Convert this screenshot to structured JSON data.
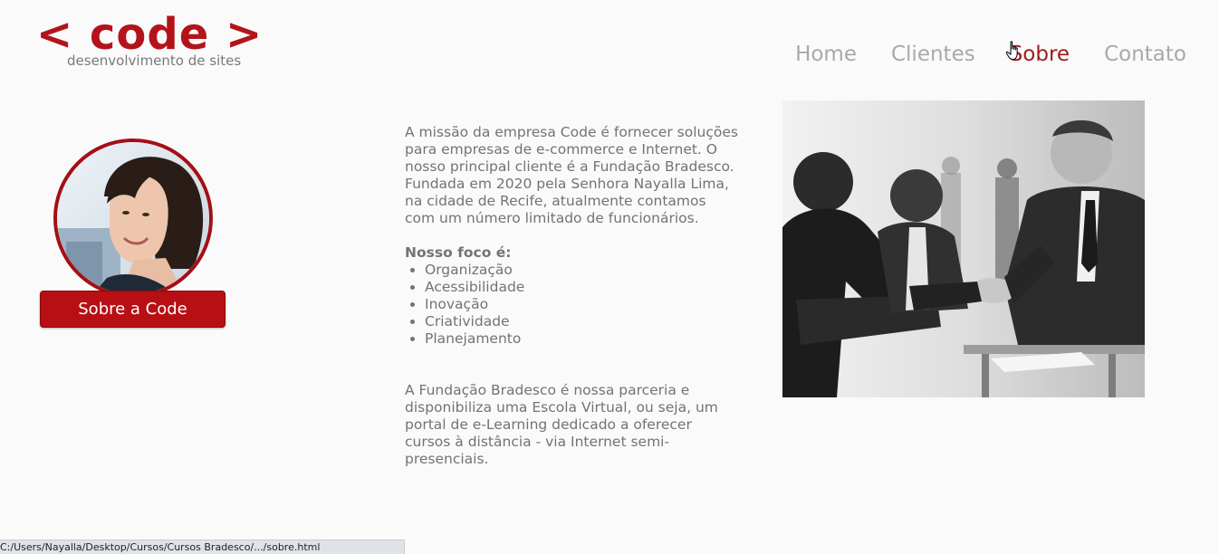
{
  "logo": {
    "brand": "< code >",
    "tagline": "desenvolvimento de sites"
  },
  "nav": {
    "items": [
      {
        "label": "Home"
      },
      {
        "label": "Clientes"
      },
      {
        "label": "Sobre"
      },
      {
        "label": "Contato"
      }
    ],
    "active": "Sobre"
  },
  "profile": {
    "button_label": "Sobre a Code"
  },
  "content": {
    "mission": "A missão da empresa Code é fornecer soluções para empresas de e-commerce e Internet. O nosso principal cliente é a Fundação Bradesco. Fundada em 2020 pela Senhora Nayalla Lima, na cidade de Recife, atualmente contamos com um número limitado de funcionários.",
    "focus_title": "Nosso foco é:",
    "focus_items": [
      "Organização",
      "Acessibilidade",
      "Inovação",
      "Criatividade",
      "Planejamento"
    ],
    "partner": "A Fundação Bradesco é nossa parceria e disponibiliza uma Escola Virtual, ou seja, um portal de e-Learning dedicado a oferecer cursos à distância - via Internet semi-presenciais."
  },
  "statusbar": {
    "url": "C:/Users/Nayalla/Desktop/Cursos/Cursos Bradesco/.../sobre.html"
  },
  "colors": {
    "brand_red": "#b3131a",
    "nav_gray": "#a9a9a9",
    "nav_active": "#9e1b1b",
    "text_gray": "#737373"
  },
  "icons": {
    "cursor": "hand-pointer-icon"
  }
}
